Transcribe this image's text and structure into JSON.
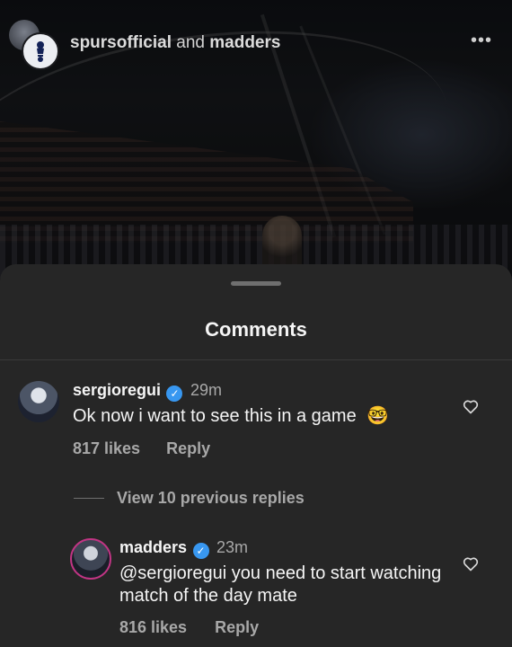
{
  "post_header": {
    "user1": "spursofficial",
    "joiner": "and",
    "user2": "madders",
    "more_icon": "more-horizontal-icon"
  },
  "sheet": {
    "title": "Comments"
  },
  "comments": [
    {
      "username": "sergioregui",
      "verified": true,
      "time": "29m",
      "text": "Ok now i want to see this in a game",
      "emoji": "🤓",
      "likes": "817 likes",
      "reply_label": "Reply"
    }
  ],
  "view_replies": "View 10 previous replies",
  "reply": {
    "username": "madders",
    "verified": true,
    "time": "23m",
    "mention": "@sergioregui",
    "text": " you need to start watching match of the day mate",
    "likes": "816 likes",
    "reply_label": "Reply"
  },
  "colors": {
    "sheet_bg": "#262626",
    "verified": "#3897f0",
    "muted_text": "#a8a8a8"
  }
}
